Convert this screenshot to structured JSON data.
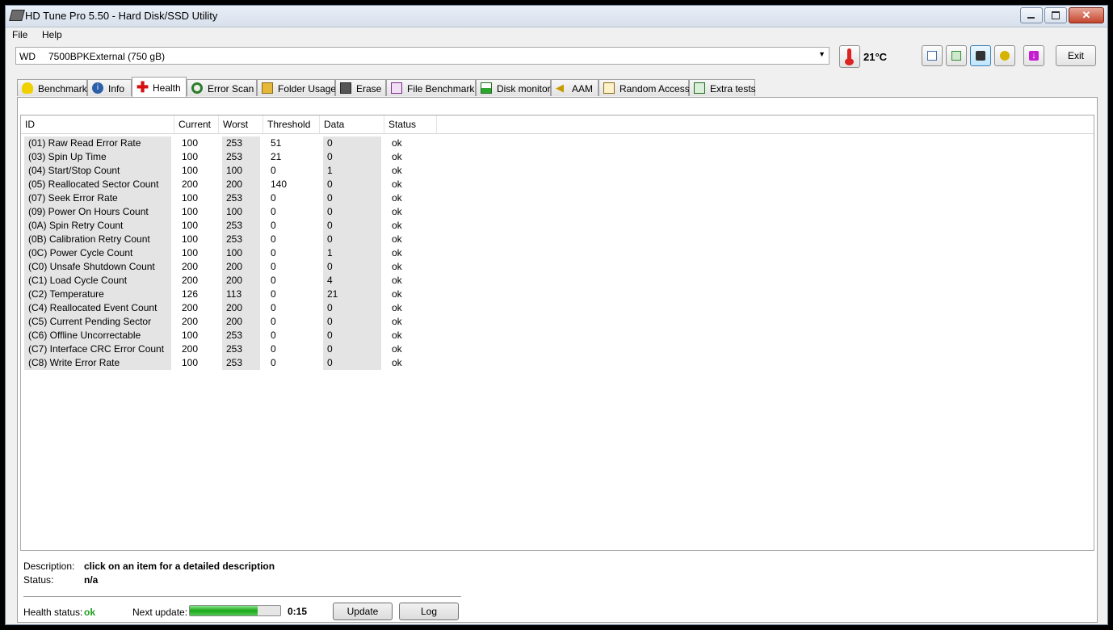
{
  "window": {
    "title": "HD Tune Pro 5.50 - Hard Disk/SSD Utility"
  },
  "menu": [
    {
      "label": "File",
      "name": "menu-file"
    },
    {
      "label": "Help",
      "name": "menu-help"
    }
  ],
  "drive": {
    "vendor": "WD",
    "model": "7500BPKExternal (750 gB)"
  },
  "temperature": "21°C",
  "toolbar": {
    "buttons": [
      {
        "name": "copy-text-button",
        "icon": "copy-text-icon"
      },
      {
        "name": "copy-screen-button",
        "icon": "copy-screen-icon"
      },
      {
        "name": "screenshot-button",
        "icon": "camera-icon"
      },
      {
        "name": "options-button",
        "icon": "options-icon"
      },
      {
        "name": "save-button",
        "icon": "download-arrow-icon"
      }
    ],
    "exit_label": "Exit"
  },
  "tabs": [
    {
      "label": "Benchmark",
      "icon": "lightbulb-icon",
      "active": false
    },
    {
      "label": "Info",
      "icon": "info-icon",
      "active": false
    },
    {
      "label": "Health",
      "icon": "red-cross-icon",
      "active": true
    },
    {
      "label": "Error Scan",
      "icon": "magnifier-icon",
      "active": false
    },
    {
      "label": "Folder Usage",
      "icon": "folder-icon",
      "active": false
    },
    {
      "label": "Erase",
      "icon": "trash-icon",
      "active": false
    },
    {
      "label": "File Benchmark",
      "icon": "file-benchmark-icon",
      "active": false
    },
    {
      "label": "Disk monitor",
      "icon": "disk-monitor-icon",
      "active": false
    },
    {
      "label": "AAM",
      "icon": "speaker-icon",
      "active": false
    },
    {
      "label": "Random Access",
      "icon": "random-access-icon",
      "active": false
    },
    {
      "label": "Extra tests",
      "icon": "extra-tests-icon",
      "active": false
    }
  ],
  "smart": {
    "columns": [
      "ID",
      "Current",
      "Worst",
      "Threshold",
      "Data",
      "Status"
    ],
    "rows": [
      [
        "(01) Raw Read Error Rate",
        "100",
        "253",
        "51",
        "0",
        "ok"
      ],
      [
        "(03) Spin Up Time",
        "100",
        "253",
        "21",
        "0",
        "ok"
      ],
      [
        "(04) Start/Stop Count",
        "100",
        "100",
        "0",
        "1",
        "ok"
      ],
      [
        "(05) Reallocated Sector Count",
        "200",
        "200",
        "140",
        "0",
        "ok"
      ],
      [
        "(07) Seek Error Rate",
        "100",
        "253",
        "0",
        "0",
        "ok"
      ],
      [
        "(09) Power On Hours Count",
        "100",
        "100",
        "0",
        "0",
        "ok"
      ],
      [
        "(0A) Spin Retry Count",
        "100",
        "253",
        "0",
        "0",
        "ok"
      ],
      [
        "(0B) Calibration Retry Count",
        "100",
        "253",
        "0",
        "0",
        "ok"
      ],
      [
        "(0C) Power Cycle Count",
        "100",
        "100",
        "0",
        "1",
        "ok"
      ],
      [
        "(C0) Unsafe Shutdown Count",
        "200",
        "200",
        "0",
        "0",
        "ok"
      ],
      [
        "(C1) Load Cycle Count",
        "200",
        "200",
        "0",
        "4",
        "ok"
      ],
      [
        "(C2) Temperature",
        "126",
        "113",
        "0",
        "21",
        "ok"
      ],
      [
        "(C4) Reallocated Event Count",
        "200",
        "200",
        "0",
        "0",
        "ok"
      ],
      [
        "(C5) Current Pending Sector",
        "200",
        "200",
        "0",
        "0",
        "ok"
      ],
      [
        "(C6) Offline Uncorrectable",
        "100",
        "253",
        "0",
        "0",
        "ok"
      ],
      [
        "(C7) Interface CRC Error Count",
        "200",
        "253",
        "0",
        "0",
        "ok"
      ],
      [
        "(C8) Write Error Rate",
        "100",
        "253",
        "0",
        "0",
        "ok"
      ]
    ]
  },
  "details": {
    "description_label": "Description:",
    "description_value": "click on an item for a detailed description",
    "status_label": "Status:",
    "status_value": "n/a"
  },
  "footer": {
    "health_label": "Health status:",
    "health_value": "ok",
    "next_label": "Next update:",
    "progress_fraction": 0.75,
    "countdown": "0:15",
    "update_label": "Update",
    "log_label": "Log"
  },
  "colors": {
    "health_ok": "#1ea01e",
    "accent_blue": "#3c7fb1"
  }
}
